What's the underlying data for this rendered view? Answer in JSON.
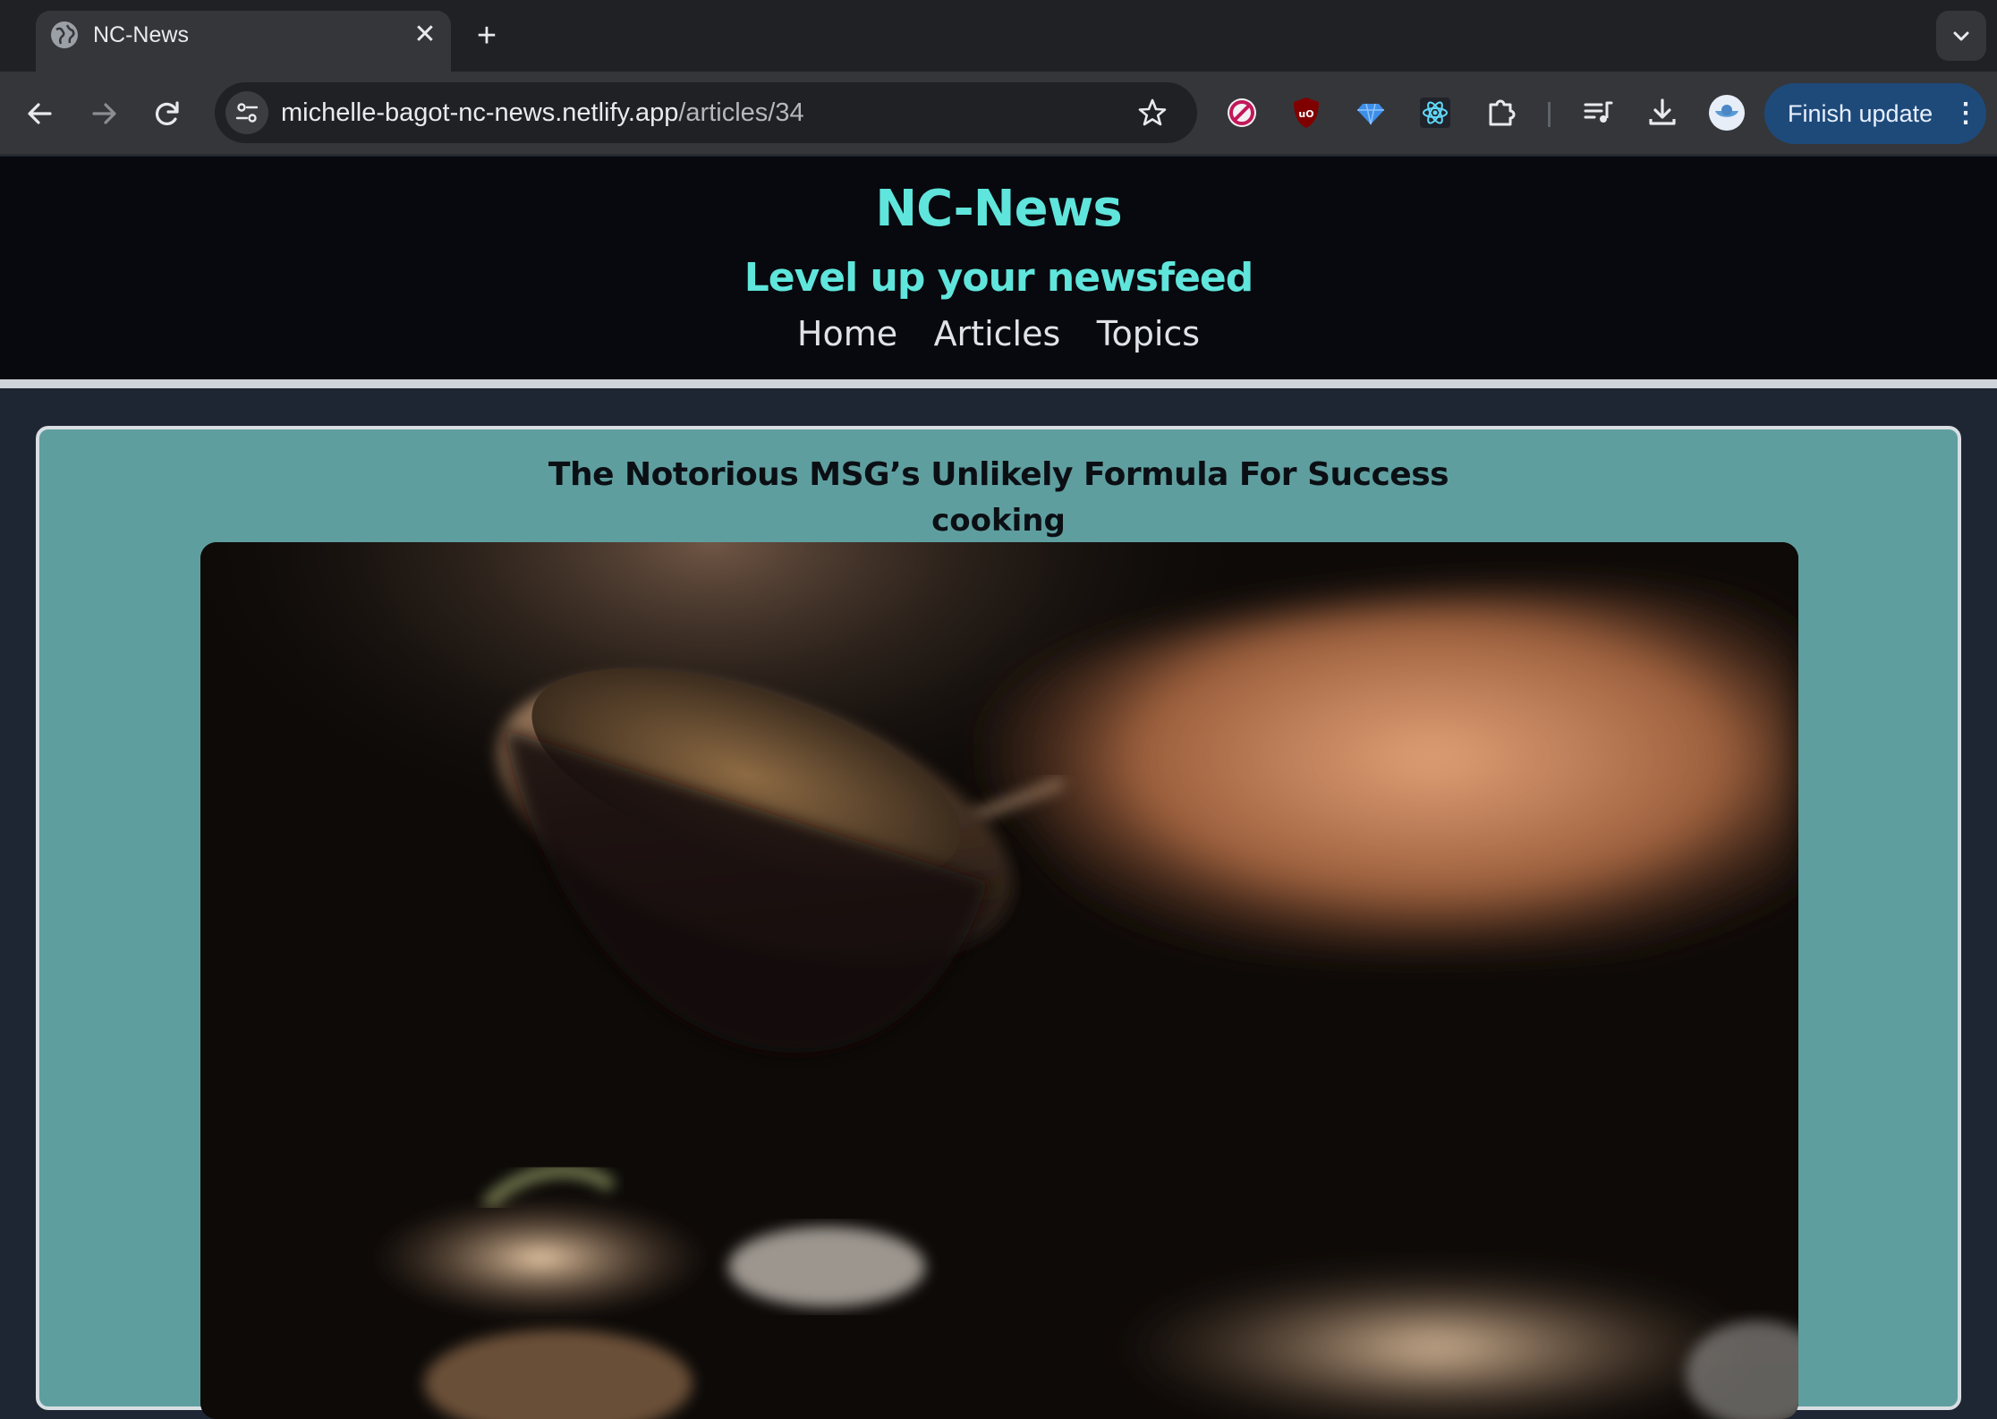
{
  "browser": {
    "tab_title": "NC-News",
    "tab_close": "✕",
    "new_tab": "+",
    "url_host": "michelle-bagot-nc-news.netlify.app",
    "url_path": "/articles/34",
    "update_button": "Finish update",
    "update_menu": "⋮",
    "icons": {
      "back": "arrow-left-icon",
      "forward": "arrow-right-icon",
      "reload": "reload-icon",
      "site_info": "site-settings-icon",
      "bookmark": "star-icon",
      "extensions": [
        "privacy-badger-icon",
        "ublock-origin-icon",
        "gem-icon",
        "react-devtools-icon",
        "puzzle-piece-icon"
      ],
      "reading_list": "queue-music-icon",
      "downloads": "download-icon",
      "profile": "avatar-icon",
      "tab_search": "chevron-down-icon"
    },
    "colors": {
      "tabstrip": "#202124",
      "toolbar": "#35363a",
      "update_button": "#1e4a7a"
    }
  },
  "site": {
    "title": "NC-News",
    "tagline": "Level up your newsfeed",
    "nav": {
      "home": "Home",
      "articles": "Articles",
      "topics": "Topics"
    },
    "colors": {
      "brand": "#5fe5dc",
      "header_bg": "#07090e",
      "card_bg": "#5f9e9f"
    }
  },
  "article": {
    "title": "The Notorious MSG’s Unlikely Formula For Success",
    "topic": "cooking",
    "image_subject": "chef-pouring-bowl-photo"
  }
}
